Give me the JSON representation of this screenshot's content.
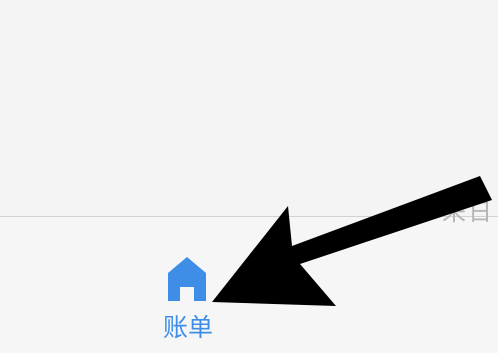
{
  "tab_bar": {
    "active_tab": {
      "label": "账单",
      "icon": "home-icon",
      "color": "#3e8ee8"
    },
    "partial_tab": {
      "label": "来日"
    }
  },
  "colors": {
    "background": "#f4f4f4",
    "divider": "#d2d2d2",
    "accent": "#3e8ee8",
    "arrow": "#000000"
  }
}
